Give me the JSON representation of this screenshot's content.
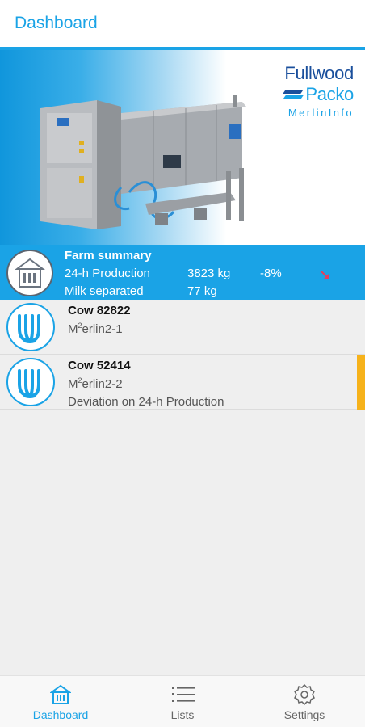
{
  "header": {
    "title": "Dashboard"
  },
  "brand": {
    "line1": "Fullwood",
    "line2": "Packo",
    "line3": "MerlinInfo"
  },
  "summary": {
    "title": "Farm summary",
    "rows": [
      {
        "label": "24-h Production",
        "value": "3823 kg",
        "change": "-8%"
      },
      {
        "label": "Milk separated",
        "value": "77 kg"
      }
    ],
    "trend_color": "#e04060"
  },
  "cows": [
    {
      "name": "Cow 82822",
      "unit_prefix": "M",
      "unit_sup": "2",
      "unit_suffix": "erlin2-1"
    },
    {
      "name": "Cow 52414",
      "unit_prefix": "M",
      "unit_sup": "2",
      "unit_suffix": "erlin2-2",
      "alert": "Deviation on 24-h Production",
      "flag_color": "#f6b21b"
    }
  ],
  "nav": {
    "dashboard": "Dashboard",
    "lists": "Lists",
    "settings": "Settings"
  },
  "colors": {
    "accent": "#1aa3e6",
    "brand_dark": "#1a4f9c"
  }
}
